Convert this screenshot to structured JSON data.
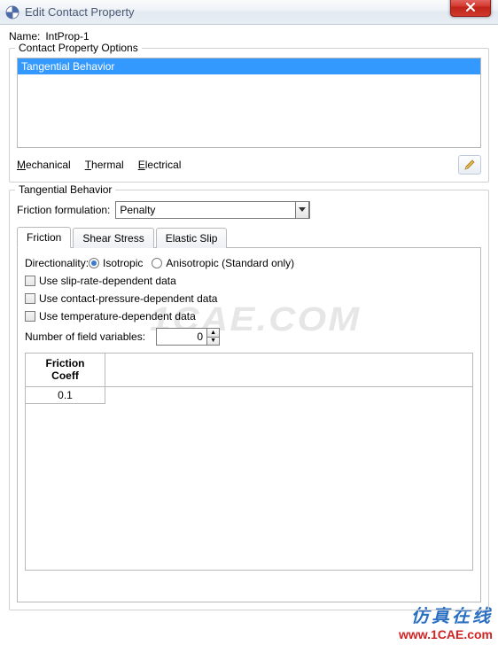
{
  "window": {
    "title": "Edit Contact Property"
  },
  "name": {
    "label": "Name:",
    "value": "IntProp-1"
  },
  "options_group": {
    "legend": "Contact Property Options",
    "items": [
      "Tangential Behavior"
    ],
    "selected_index": 0
  },
  "menus": {
    "mechanical": "Mechanical",
    "thermal": "Thermal",
    "electrical": "Electrical"
  },
  "tangential": {
    "legend": "Tangential Behavior",
    "friction_formulation_label": "Friction formulation:",
    "friction_formulation_value": "Penalty",
    "tabs": {
      "friction": "Friction",
      "shear": "Shear Stress",
      "slip": "Elastic Slip"
    },
    "friction_tab": {
      "directionality_label": "Directionality:",
      "isotropic_label": "Isotropic",
      "anisotropic_label": "Anisotropic (Standard only)",
      "slip_rate_label": "Use slip-rate-dependent data",
      "pressure_label": "Use contact-pressure-dependent data",
      "temperature_label": "Use temperature-dependent data",
      "field_vars_label": "Number of field variables:",
      "field_vars_value": "0",
      "table_header": "Friction\nCoeff",
      "table_rows": [
        "0.1"
      ]
    }
  },
  "watermark": {
    "faint": "1CAE.COM",
    "cn": "仿真在线",
    "url": "www.1CAE.com"
  }
}
